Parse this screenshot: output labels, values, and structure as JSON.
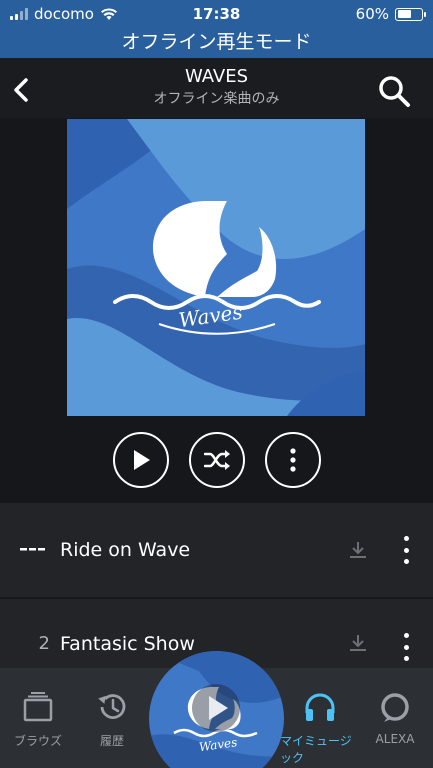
{
  "status_bar": {
    "carrier": "docomo",
    "time": "17:38",
    "battery_percent": "60%",
    "battery_level": 0.6
  },
  "offline_banner": "オフライン再生モード",
  "header": {
    "title": "WAVES",
    "subtitle": "オフライン楽曲のみ"
  },
  "album": {
    "logo_text": "Waves"
  },
  "tracks": [
    {
      "number": "",
      "title": "Ride on Wave",
      "playing": true
    },
    {
      "number": "2",
      "title": "Fantasic Show",
      "playing": false
    }
  ],
  "tabs": [
    {
      "label": "ブラウズ",
      "icon": "browse-icon"
    },
    {
      "label": "履歴",
      "icon": "history-icon"
    },
    {
      "label": "マイミュージック",
      "icon": "headphones-icon",
      "active": true
    },
    {
      "label": "ALEXA",
      "icon": "alexa-icon"
    }
  ],
  "colors": {
    "accent": "#4dc3f5",
    "status_bar_bg": "#2a5f9e",
    "background": "#15171a"
  }
}
